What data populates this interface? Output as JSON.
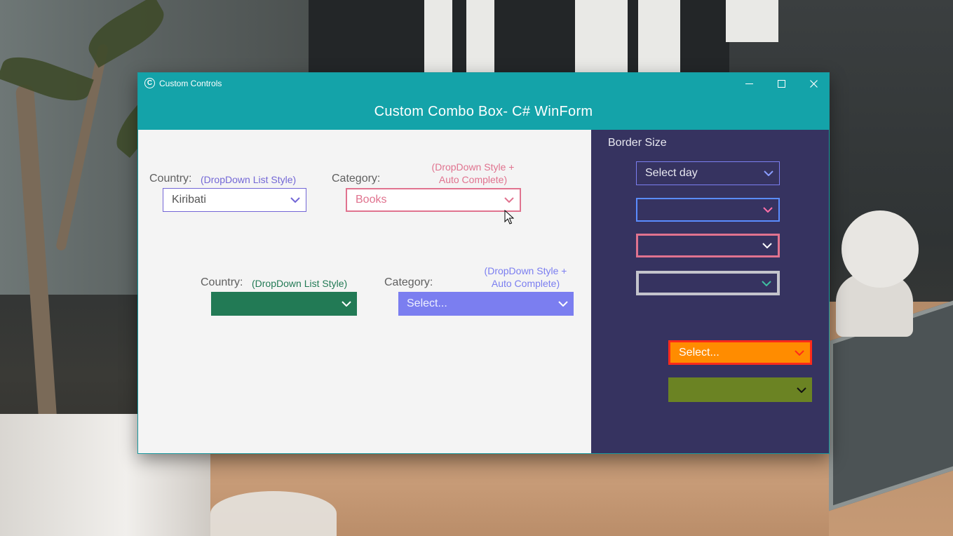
{
  "window": {
    "title": "Custom Controls",
    "app_icon": "C",
    "header_title": "Custom Combo Box- C# WinForm",
    "controls": {
      "minimize_icon": "minimize-icon",
      "maximize_icon": "maximize-icon",
      "close_icon": "close-icon"
    }
  },
  "left": {
    "row1": {
      "country_label": "Country:",
      "country_hint": "(DropDown List Style)",
      "country_value": "Kiribati",
      "category_label": "Category:",
      "category_hint_line1": "(DropDown Style +",
      "category_hint_line2": "Auto Complete)",
      "category_value": "Books"
    },
    "row2": {
      "country_label": "Country:",
      "country_hint": "(DropDown List Style)",
      "country_value": "",
      "category_label": "Category:",
      "category_hint_line1": "(DropDown Style +",
      "category_hint_line2": "Auto Complete)",
      "category_value": "Select..."
    }
  },
  "right": {
    "heading": "Border Size",
    "combos": [
      {
        "value": "Select day"
      },
      {
        "value": ""
      },
      {
        "value": ""
      },
      {
        "value": ""
      },
      {
        "value": "Select..."
      },
      {
        "value": ""
      }
    ]
  },
  "colors": {
    "titlebar": "#14a3a9",
    "right_panel": "#363360",
    "purple": "#7367d6",
    "pink": "#e0738f",
    "green": "#227a55",
    "periwinkle": "#7b7ef0",
    "orange": "#ff8c00",
    "red_border": "#ff2a1a",
    "olive": "#6b8323"
  }
}
